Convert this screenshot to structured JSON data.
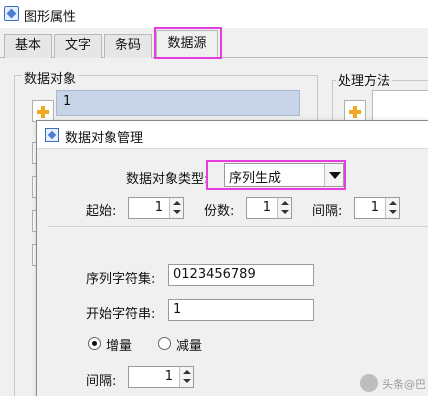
{
  "window": {
    "title": "图形属性"
  },
  "tabs": [
    {
      "label": "基本",
      "active": false
    },
    {
      "label": "文字",
      "active": false
    },
    {
      "label": "条码",
      "active": false
    },
    {
      "label": "数据源",
      "active": true
    }
  ],
  "left_group": {
    "label": "数据对象",
    "selected_item": "1"
  },
  "right_group": {
    "label": "处理方法"
  },
  "dialog": {
    "title": "数据对象管理",
    "type_label": "数据对象类型:",
    "type_value": "序列生成",
    "start_label": "起始:",
    "start_value": "1",
    "copies_label": "份数:",
    "copies_value": "1",
    "interval_label": "间隔:",
    "interval_value": "1",
    "charset_label": "序列字符集:",
    "charset_value": "0123456789",
    "start_string_label": "开始字符串:",
    "start_string_value": "1",
    "increment_label": "增量",
    "decrement_label": "减量",
    "mode_selected": "increment",
    "step_label": "间隔:",
    "step_value": "1"
  },
  "watermark": {
    "text": "头条@巴"
  },
  "colors": {
    "highlight": "#e43ee0",
    "selection": "#c8d4e8",
    "accent_plus": "#f1a820"
  }
}
